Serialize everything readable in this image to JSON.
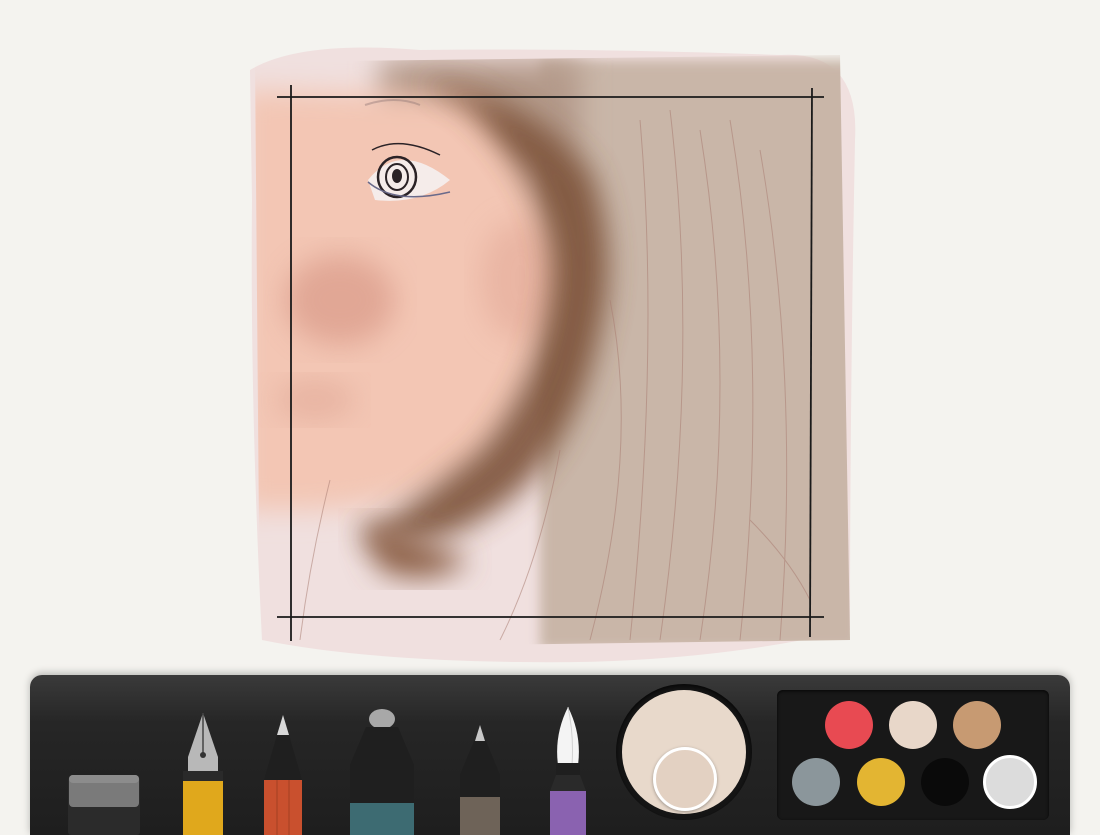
{
  "app": {
    "name": ""
  },
  "canvas": {
    "description_colors": {
      "background": "#f4f3ef",
      "skin": "#f0c2b2",
      "hair_dark": "#7a5038",
      "hair_light": "#c9b4a6",
      "frame_line": "#1a1a1a"
    }
  },
  "tools": [
    {
      "id": "eraser",
      "icon": "eraser-icon",
      "color": "#2b2b2b"
    },
    {
      "id": "fountain-pen",
      "icon": "fountain-pen-icon",
      "color": "#e0a81c"
    },
    {
      "id": "pencil",
      "icon": "pencil-icon",
      "color": "#c9502e"
    },
    {
      "id": "marker",
      "icon": "marker-icon",
      "color": "#3d6b72"
    },
    {
      "id": "fineliner",
      "icon": "fineliner-icon",
      "color": "#6e6358"
    },
    {
      "id": "brush",
      "icon": "brush-icon",
      "color": "#8a62b0",
      "selected": true
    }
  ],
  "current_color": {
    "primary": "#e8d9cb",
    "secondary": "#e3d1c2"
  },
  "palette": [
    {
      "color": "#e84a52"
    },
    {
      "color": "#e8d7c9"
    },
    {
      "color": "#c79a72"
    },
    {
      "color": "#8b969b"
    },
    {
      "color": "#e3b532"
    },
    {
      "color": "#0a0a0a"
    },
    {
      "color": "#dcdcdc",
      "selected": true
    }
  ]
}
